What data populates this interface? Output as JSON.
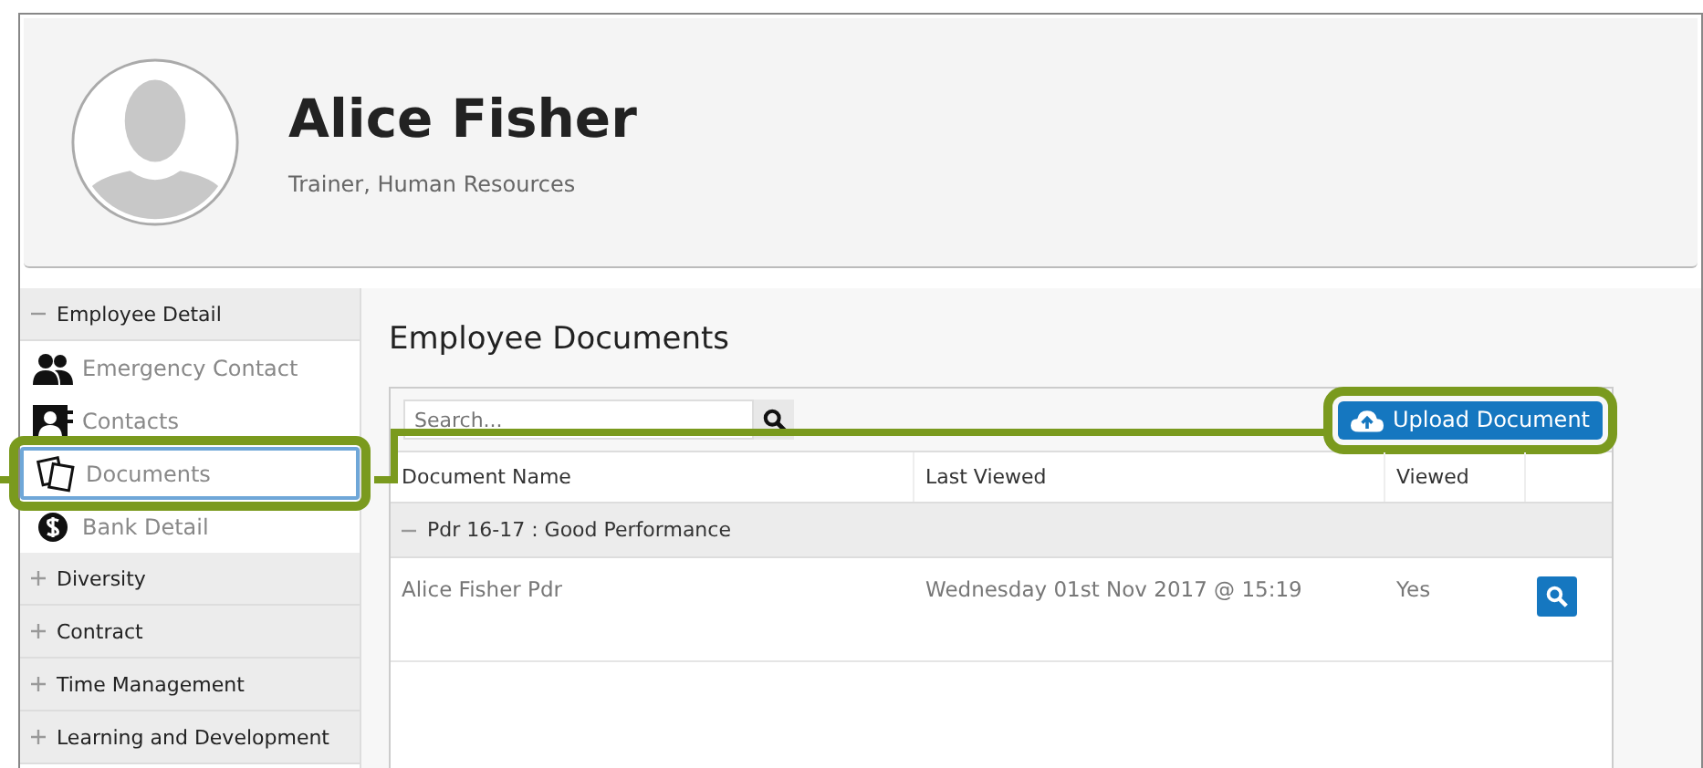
{
  "profile": {
    "name": "Alice Fisher",
    "subtitle": "Trainer, Human Resources"
  },
  "sidebar": {
    "sections": [
      {
        "label": "Employee Detail",
        "expanded": true,
        "children": [
          {
            "label": "Emergency Contact",
            "selected": false,
            "highlighted": false
          },
          {
            "label": "Contacts",
            "selected": false,
            "highlighted": false
          },
          {
            "label": "Documents",
            "selected": true,
            "highlighted": true
          },
          {
            "label": "Bank Detail",
            "selected": false,
            "highlighted": false
          }
        ]
      },
      {
        "label": "Diversity",
        "expanded": false
      },
      {
        "label": "Contract",
        "expanded": false
      },
      {
        "label": "Time Management",
        "expanded": false
      },
      {
        "label": "Learning and Development",
        "expanded": false
      }
    ]
  },
  "main": {
    "title": "Employee Documents",
    "search": {
      "placeholder": "Search..."
    },
    "upload_button": {
      "label": "Upload Document",
      "highlighted": true
    },
    "table": {
      "columns": [
        "Document Name",
        "Last Viewed",
        "Viewed"
      ],
      "groups": [
        {
          "label": "Pdr 16-17 : Good Performance",
          "expanded": true,
          "rows": [
            {
              "cells": [
                "Alice Fisher Pdr",
                "Wednesday 01st Nov 2017 @ 15:19",
                "Yes"
              ]
            }
          ]
        }
      ]
    }
  }
}
